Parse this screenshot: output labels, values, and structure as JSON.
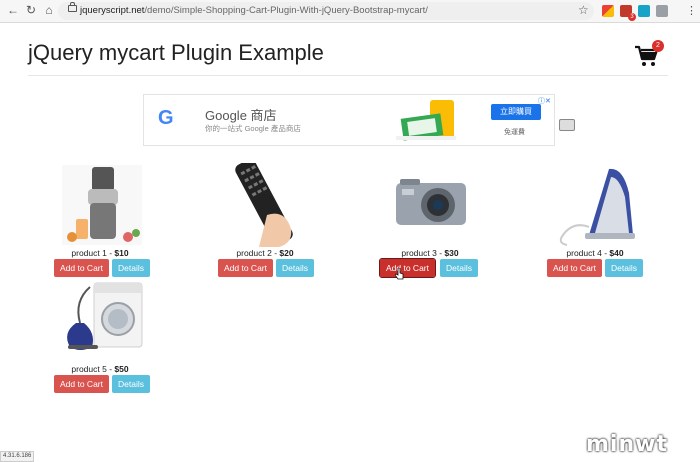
{
  "browser": {
    "url_host": "jqueryscript.net",
    "url_path": "/demo/Simple-Shopping-Cart-Plugin-With-jQuery-Bootstrap-mycart/",
    "ext_badge": "3"
  },
  "page": {
    "title": "jQuery mycart Plugin Example",
    "cart_count": "2"
  },
  "ad": {
    "logo": "G",
    "title": "Google 商店",
    "subtitle": "你的一站式 Google 產品商店",
    "button": "立即購買",
    "free": "免運費"
  },
  "buttons": {
    "add": "Add to Cart",
    "details": "Details"
  },
  "products": [
    {
      "name": "product 1",
      "price": "$10"
    },
    {
      "name": "product 2",
      "price": "$20"
    },
    {
      "name": "product 3",
      "price": "$30"
    },
    {
      "name": "product 4",
      "price": "$40"
    },
    {
      "name": "product 5",
      "price": "$50"
    }
  ],
  "status_text": "4.31.6.186",
  "watermark": "minwt"
}
